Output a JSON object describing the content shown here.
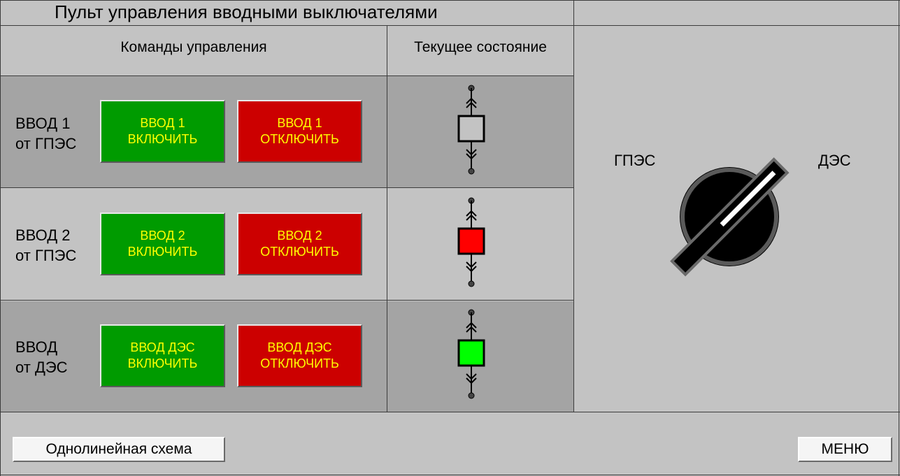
{
  "title": "Пульт управления вводными выключателями",
  "headers": {
    "commands": "Команды управления",
    "state": "Текущее состояние"
  },
  "rows": [
    {
      "label_line1": "ВВОД 1",
      "label_line2": "от ГПЭС",
      "on_line1": "ВВОД 1",
      "on_line2": "ВКЛЮЧИТЬ",
      "off_line1": "ВВОД 1",
      "off_line2": "ОТКЛЮЧИТЬ",
      "breaker_color": "#c3c3c3"
    },
    {
      "label_line1": "ВВОД 2",
      "label_line2": "от ГПЭС",
      "on_line1": "ВВОД 2",
      "on_line2": "ВКЛЮЧИТЬ",
      "off_line1": "ВВОД 2",
      "off_line2": "ОТКЛЮЧИТЬ",
      "breaker_color": "#ff0000"
    },
    {
      "label_line1": "ВВОД",
      "label_line2": "от ДЭС",
      "on_line1": "ВВОД ДЭС",
      "on_line2": "ВКЛЮЧИТЬ",
      "off_line1": "ВВОД ДЭС",
      "off_line2": "ОТКЛЮЧИТЬ",
      "breaker_color": "#00ff00"
    }
  ],
  "selector": {
    "left_label": "ГПЭС",
    "right_label": "ДЭС",
    "position": "ГПЭС"
  },
  "buttons": {
    "single_line": "Однолинейная схема",
    "menu": "МЕНЮ"
  },
  "colors": {
    "on_button": "#009b00",
    "off_button": "#cc0000",
    "button_text": "#ffff00",
    "breaker_off": "#c3c3c3",
    "breaker_fault": "#ff0000",
    "breaker_on": "#00ff00"
  }
}
